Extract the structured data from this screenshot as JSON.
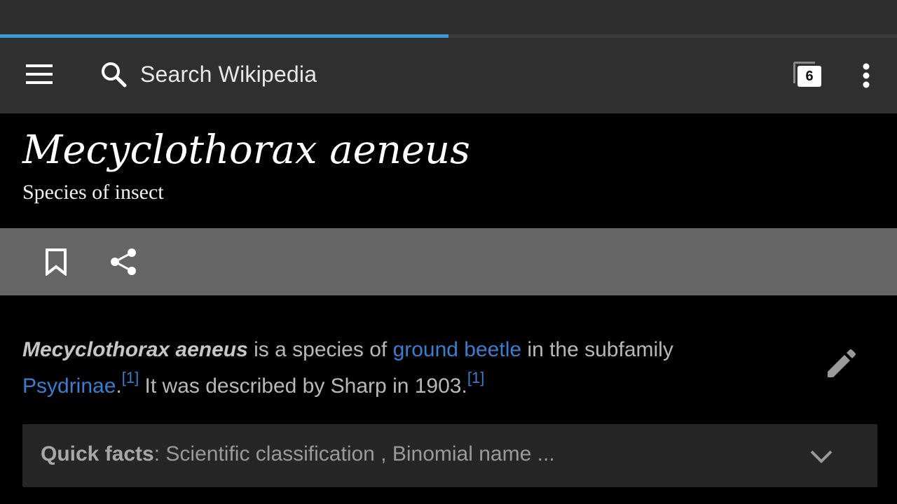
{
  "progress": {
    "value": 0.5
  },
  "toolbar": {
    "search_placeholder": "Search Wikipedia",
    "tab_count": "6"
  },
  "article": {
    "title": "Mecyclothorax aeneus",
    "subtitle": "Species of insect",
    "lead": {
      "bold_name": "Mecyclothorax aeneus",
      "text_1": " is a species of ",
      "link_1": "ground beetle",
      "text_2": " in the subfamily ",
      "link_2": "Psydrinae",
      "text_3": ".",
      "ref_1": "[1]",
      "text_4": " It was described by Sharp in 1903.",
      "ref_2": "[1]"
    },
    "quick_facts": {
      "label": "Quick facts",
      "summary": ": Scientific classification , Binomial name ..."
    }
  },
  "icons": {
    "menu": "menu-icon",
    "search": "search-icon",
    "tabs": "tabs-icon",
    "overflow": "more-vert-icon",
    "bookmark": "bookmark-icon",
    "share": "share-icon",
    "edit": "pencil-icon",
    "expand": "chevron-down-icon"
  },
  "colors": {
    "toolbar_bg": "#303030",
    "progress": "#3a9ad9",
    "link": "#3a7fcf",
    "action_bar": "#666666"
  }
}
